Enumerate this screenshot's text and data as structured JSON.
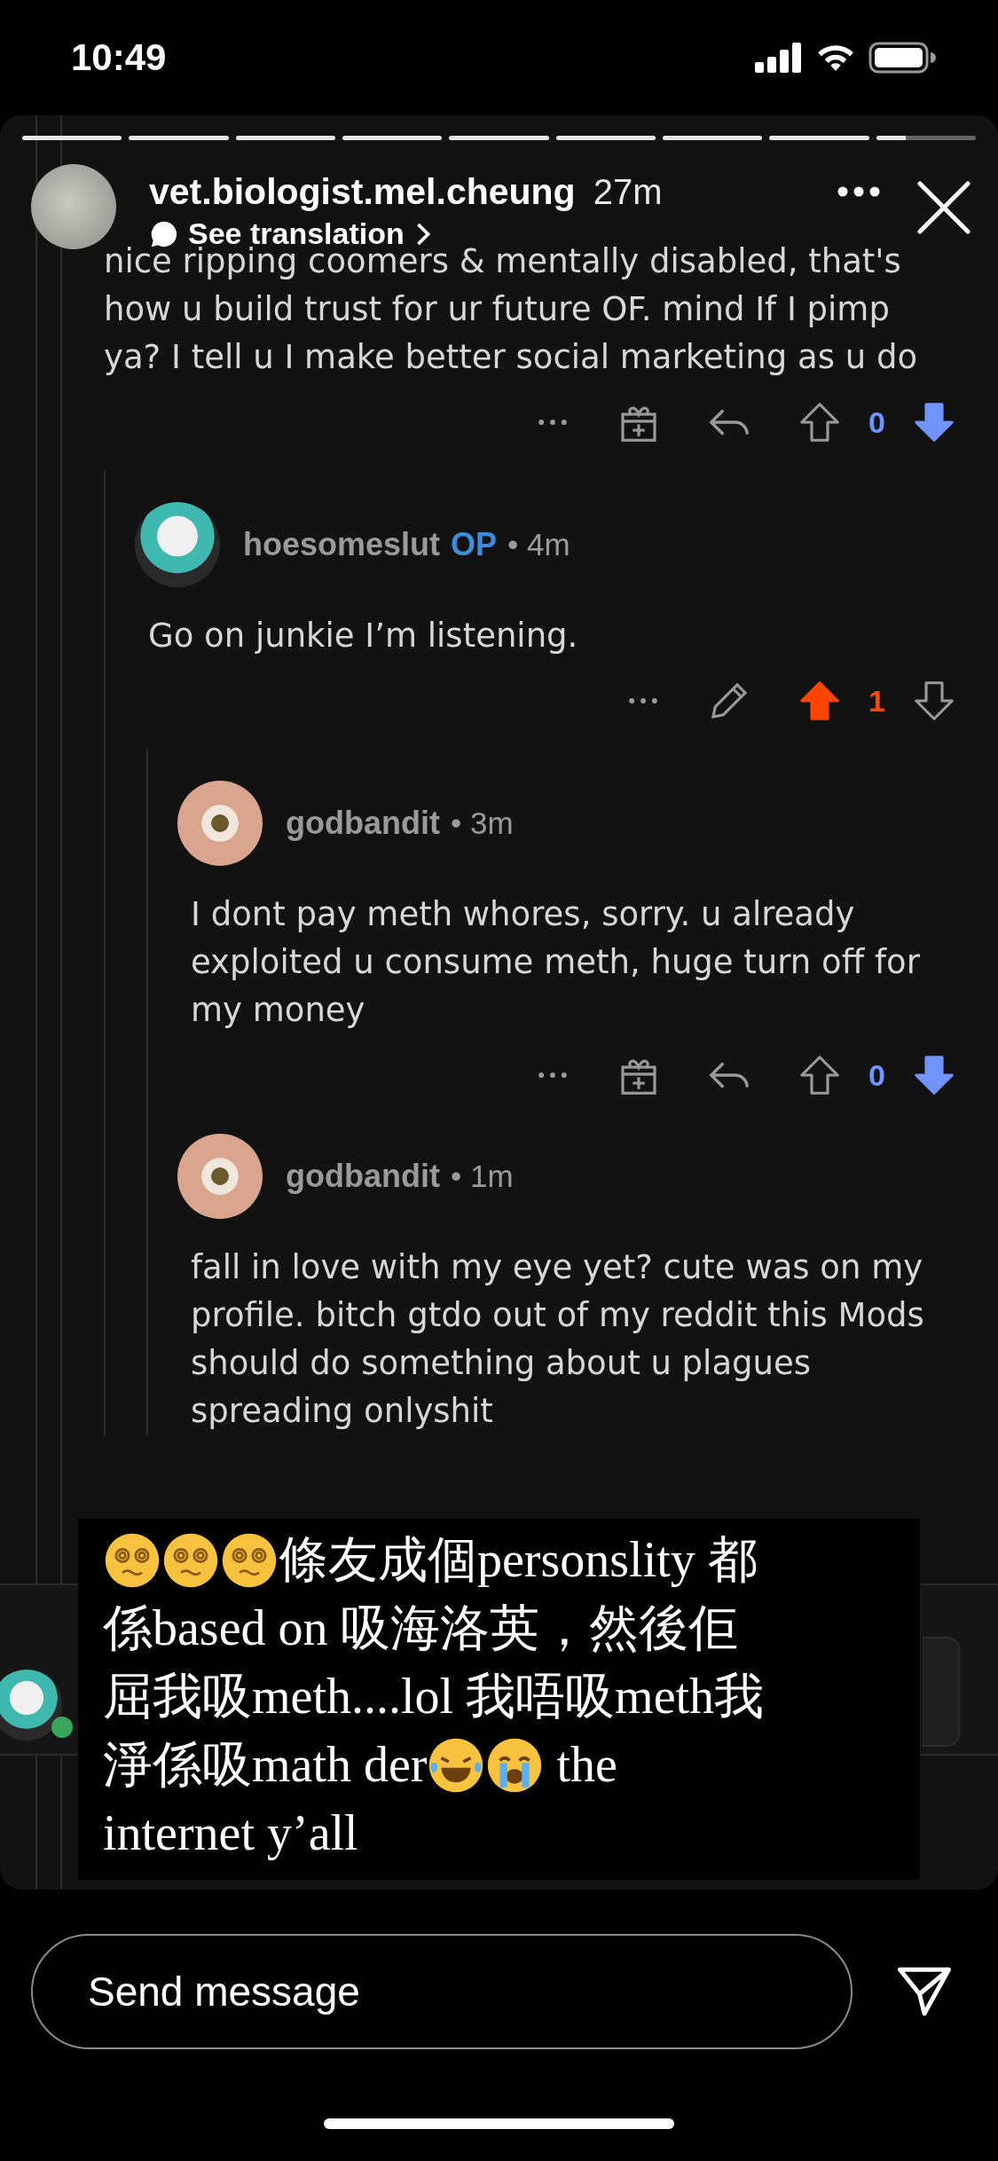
{
  "status_bar": {
    "time": "10:49"
  },
  "story": {
    "progress_segments": [
      {
        "level": 1
      },
      {
        "level": 1
      },
      {
        "level": 1
      },
      {
        "level": 1
      },
      {
        "level": 1
      },
      {
        "level": 1
      },
      {
        "level": 1
      },
      {
        "level": 1
      },
      {
        "level": 0.3
      }
    ],
    "author": {
      "username": "vet.biologist.mel.cheung",
      "time": "27m",
      "translation_link": "See translation"
    }
  },
  "comments": [
    {
      "body": "nice ripping coomers & mentally disabled, that's how u build trust for ur future OF. mind If I pimp ya? I tell u I make better social marketing as u do",
      "actions": {
        "kind": "other",
        "score": "0",
        "upvoted": false,
        "downvoted": true
      },
      "children": [
        {
          "username": "hoesomeslut",
          "badge": "OP",
          "time": "• 4m",
          "body": "Go on junkie I’m listening.",
          "actions": {
            "kind": "own",
            "score": "1",
            "upvoted": true,
            "downvoted": false
          },
          "children": [
            {
              "username": "godbandit",
              "time": "• 3m",
              "body": "I dont pay meth whores, sorry. u already exploited u consume meth, huge turn off for my money",
              "actions": {
                "kind": "other",
                "score": "0",
                "upvoted": false,
                "downvoted": true
              }
            },
            {
              "username": "godbandit",
              "time": "• 1m",
              "body": "fall in love with my eye yet? cute was on my profile. bitch gtdo out of my reddit this Mods should do something about u plagues spreading onlyshit"
            }
          ]
        }
      ]
    }
  ],
  "caption": [
    {
      "parts": [
        {
          "kind": "spiral-face"
        },
        {
          "kind": "spiral-face"
        },
        {
          "kind": "spiral-face"
        },
        {
          "kind": "text",
          "text": "條友成個personslity 都"
        }
      ]
    },
    {
      "parts": [
        {
          "kind": "text",
          "text": "係based on 吸海洛英，然後佢"
        }
      ]
    },
    {
      "parts": [
        {
          "kind": "text",
          "text": "屈我吸meth....lol 我唔吸meth我"
        }
      ]
    },
    {
      "parts": [
        {
          "kind": "text",
          "text": "淨係吸math der"
        },
        {
          "kind": "laughing-face"
        },
        {
          "kind": "crying-face"
        },
        {
          "kind": "text",
          "text": " the"
        }
      ]
    },
    {
      "parts": [
        {
          "kind": "text",
          "text": "internet y’all"
        }
      ]
    }
  ],
  "message_field": {
    "placeholder": "Send message"
  }
}
